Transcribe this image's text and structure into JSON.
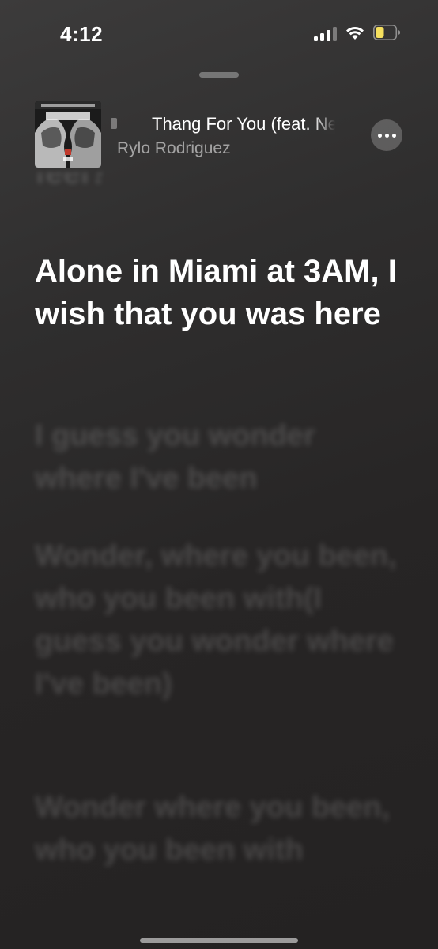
{
  "status_bar": {
    "time": "4:12",
    "signal_bars_active": 3,
    "signal_bars_total": 4,
    "battery_level": 0.35,
    "battery_color": "#f6e05e"
  },
  "now_playing": {
    "title": "Thang For You (feat. Ne",
    "artist": "Rylo Rodriguez",
    "more_icon": "ellipsis-icon"
  },
  "lyrics": {
    "previous": "feel?",
    "current": "Alone in Miami at 3AM, I wish that you was here",
    "upcoming": [
      "I guess you wonder where I've been",
      "Wonder, where you been, who you been with(I guess you wonder where I've been)",
      "Wonder where you been, who you been with"
    ]
  },
  "colors": {
    "background": "#2c2b2b",
    "active_lyric": "#ffffff"
  }
}
